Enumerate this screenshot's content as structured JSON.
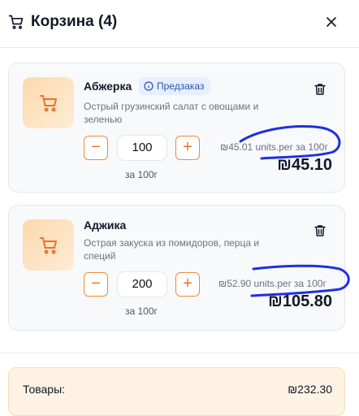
{
  "header": {
    "title": "Корзина (4)"
  },
  "items": [
    {
      "name": "Абжерка",
      "badge": "Предзаказ",
      "description": "Острый грузинский салат с овощами и зеленью",
      "quantity": "100",
      "unit_label": "за 100г",
      "per_unit": "₪45.01 units.per за 100г",
      "price": "₪45.10"
    },
    {
      "name": "Аджика",
      "description": "Острая закуска из помидоров, перца и специй",
      "quantity": "200",
      "unit_label": "за 100г",
      "per_unit": "₪52.90 units.per за 100г",
      "price": "₪105.80"
    }
  ],
  "summary": {
    "label": "Товары:",
    "value": "₪232.30"
  },
  "colors": {
    "accent": "#f08a3a",
    "badge_bg": "#e6efff",
    "annotation": "#1f2fe0"
  }
}
